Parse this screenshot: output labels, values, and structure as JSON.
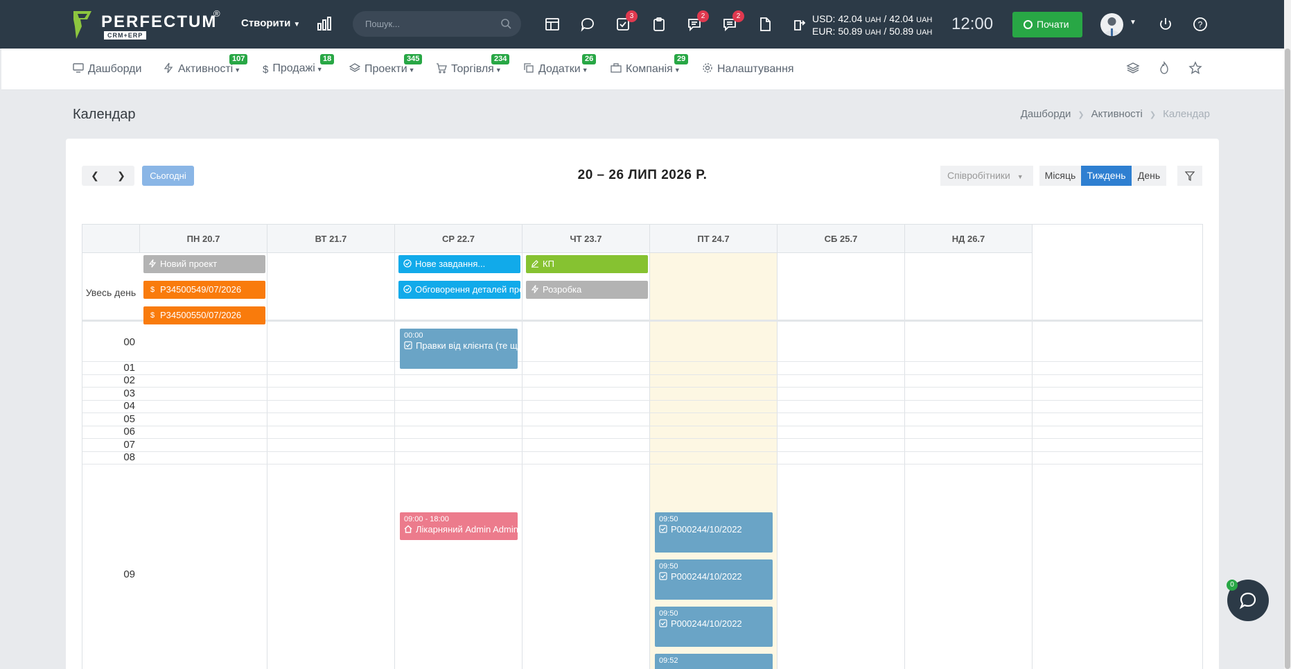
{
  "app": {
    "logo": {
      "name": "PERFECTUM",
      "tag": "CRM+ERP",
      "registered": "®"
    },
    "create_label": "Створити",
    "search": {
      "placeholder": "Пошук..."
    },
    "badges": {
      "tasks": "3",
      "messages": "2",
      "comments": "2"
    },
    "currency": {
      "usd": {
        "label": "USD:",
        "buy": "42.04",
        "sell": "42.04",
        "unit": "UAH"
      },
      "eur": {
        "label": "EUR:",
        "buy": "50.89",
        "sell": "50.89",
        "unit": "UAH"
      }
    },
    "clock": "12:00",
    "start_label": "Почати"
  },
  "nav": {
    "items": [
      {
        "label": "Дашборди",
        "badge": ""
      },
      {
        "label": "Активності",
        "badge": "107"
      },
      {
        "label": "Продажі",
        "badge": "18"
      },
      {
        "label": "Проекти",
        "badge": "345"
      },
      {
        "label": "Торгівля",
        "badge": "234"
      },
      {
        "label": "Додатки",
        "badge": "26"
      },
      {
        "label": "Компанія",
        "badge": "29"
      },
      {
        "label": "Налаштування",
        "badge": ""
      }
    ]
  },
  "page": {
    "title": "Календар",
    "breadcrumb": [
      "Дашборди",
      "Активності",
      "Календар"
    ]
  },
  "calendar": {
    "today_label": "Сьогодні",
    "range_title": "20 – 26 ЛИП 2026 Р.",
    "employees_label": "Співробітники",
    "views": [
      "Місяць",
      "Тиждень",
      "День"
    ],
    "active_view": "Тиждень",
    "allday_label": "Увесь день",
    "days": [
      "ПН 20.7",
      "ВТ 21.7",
      "СР 22.7",
      "ЧТ 23.7",
      "ПТ 24.7",
      "СБ 25.7",
      "НД 26.7"
    ],
    "today_index": 4,
    "hours": [
      "00",
      "01",
      "02",
      "03",
      "04",
      "05",
      "06",
      "07",
      "08",
      "09"
    ],
    "allday_events": [
      {
        "day": 0,
        "title": "Новий проект",
        "icon": "bolt-icon",
        "color": "#b3b3b3"
      },
      {
        "day": 0,
        "title": "Р34500549/07/2026",
        "icon": "dollar-icon",
        "color": "#f97b0c"
      },
      {
        "day": 0,
        "title": "Р34500550/07/2026",
        "icon": "dollar-icon",
        "color": "#f97b0c"
      },
      {
        "day": 2,
        "title": "Нове завдання...",
        "icon": "check-circle-icon",
        "color": "#11aaea"
      },
      {
        "day": 2,
        "title": "Обговорення деталей пропозиції",
        "icon": "check-circle-icon",
        "color": "#11aaea"
      },
      {
        "day": 3,
        "title": "КП",
        "icon": "pencil-icon",
        "color": "#86c231"
      },
      {
        "day": 3,
        "title": "Розробка",
        "icon": "bolt-icon",
        "color": "#b3b3b3"
      }
    ],
    "timed_events": [
      {
        "day": 2,
        "time": "00:00",
        "title": "Правки від клієнта (те що ...",
        "icon": "check-square-icon",
        "color": "#6aa4c6"
      },
      {
        "day": 2,
        "time": "09:00 - 18:00",
        "title": "Лікарняний Admin Admin",
        "icon": "home-icon",
        "color": "#ec7b8c"
      },
      {
        "day": 4,
        "time": "09:50",
        "title": "Р000244/10/2022",
        "icon": "check-square-icon",
        "color": "#6aa4c6"
      },
      {
        "day": 4,
        "time": "09:50",
        "title": "Р000244/10/2022",
        "icon": "check-square-icon",
        "color": "#6aa4c6"
      },
      {
        "day": 4,
        "time": "09:50",
        "title": "Р000244/10/2022",
        "icon": "check-square-icon",
        "color": "#6aa4c6"
      },
      {
        "day": 4,
        "time": "09:52",
        "title": "",
        "icon": "check-square-icon",
        "color": "#6aa4c6"
      }
    ]
  },
  "chat": {
    "badge": "0"
  }
}
